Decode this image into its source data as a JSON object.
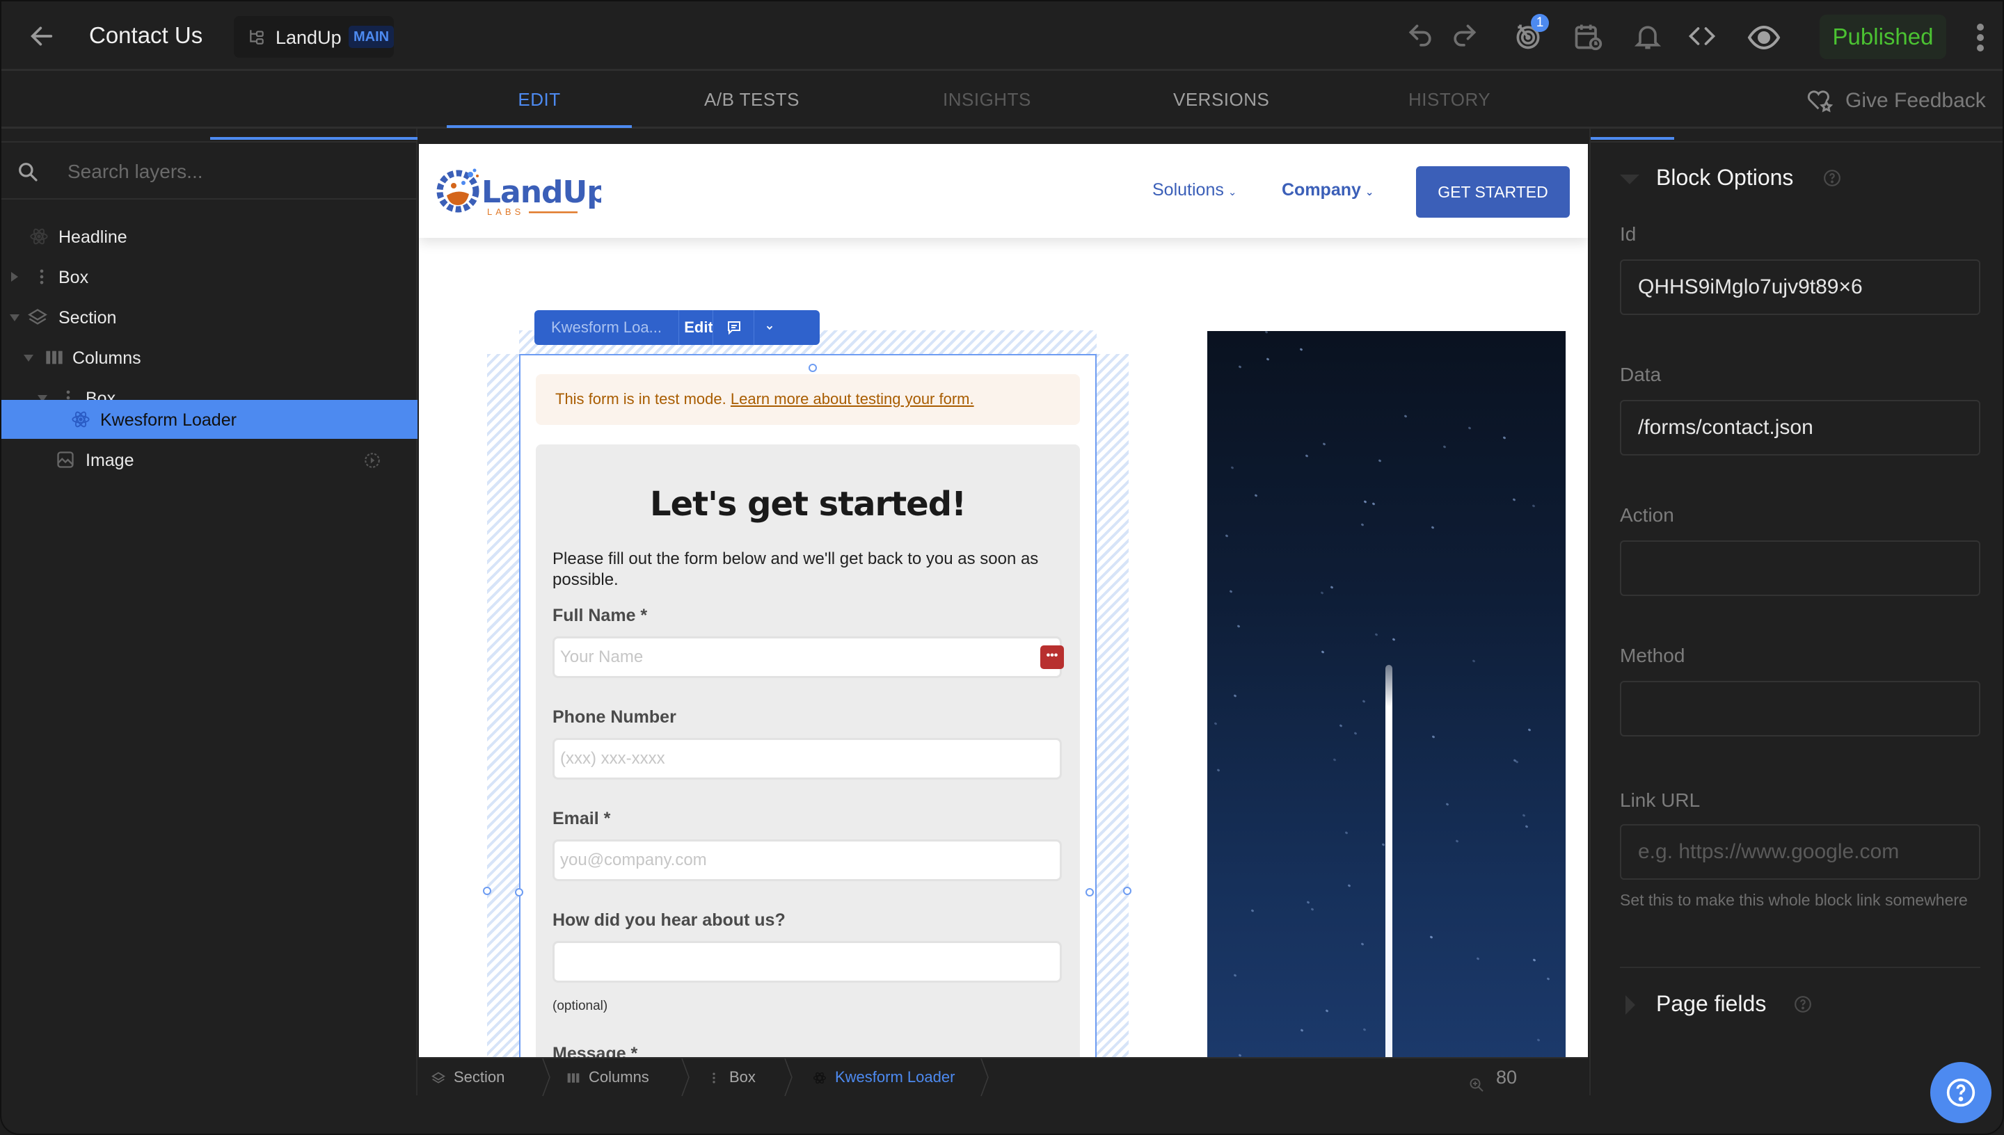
{
  "topbar": {
    "page_title": "Contact Us",
    "project_name": "LandUp",
    "branch_badge": "MAIN",
    "goals_badge_count": "1",
    "published_label": "Published",
    "icons": [
      "back-arrow-icon",
      "branch-icon",
      "undo-icon",
      "redo-icon",
      "goal-target-icon",
      "schedule-calendar-icon",
      "bell-icon",
      "code-icon",
      "eye-preview-icon",
      "more-vertical-icon"
    ]
  },
  "tabs": [
    {
      "label": "EDIT",
      "active": true,
      "color": "#4d8af0"
    },
    {
      "label": "A/B TESTS",
      "active": false,
      "color": "#a0a0a0"
    },
    {
      "label": "INSIGHTS",
      "active": false,
      "color": "#5a5a5a"
    },
    {
      "label": "VERSIONS",
      "active": false,
      "color": "#a0a0a0"
    },
    {
      "label": "HISTORY",
      "active": false,
      "color": "#5a5a5a"
    }
  ],
  "feedback_label": "Give Feedback",
  "layers": {
    "search_placeholder": "Search layers...",
    "items": [
      {
        "label": "Headline",
        "icon": "component-atom-icon",
        "depth": 0,
        "caret": "none"
      },
      {
        "label": "Box",
        "icon": "box-dots-icon",
        "depth": 0,
        "caret": "right"
      },
      {
        "label": "Section",
        "icon": "layers-icon",
        "depth": 0,
        "caret": "down"
      },
      {
        "label": "Columns",
        "icon": "columns-icon",
        "depth": 1,
        "caret": "down"
      },
      {
        "label": "Box",
        "icon": "box-dots-icon",
        "depth": 2,
        "caret": "down"
      },
      {
        "label": "Kwesform Loader",
        "icon": "component-atom-icon",
        "depth": 3,
        "caret": "none",
        "selected": true
      },
      {
        "label": "Image",
        "icon": "image-icon",
        "depth": 2,
        "caret": "none"
      }
    ]
  },
  "site": {
    "logo_text": "LandUp",
    "logo_sub": "LABS",
    "nav": [
      {
        "label": "Solutions"
      },
      {
        "label": "Company"
      }
    ],
    "cta_label": "GET STARTED"
  },
  "block_toolbar": {
    "name": "Kwesform Loa...",
    "edit_label": "Edit"
  },
  "form": {
    "test_banner_text": "This form is in test mode.",
    "test_banner_link": "Learn more about testing your form.",
    "title": "Let's get started!",
    "description": "Please fill out the form below and we'll get back to you as soon as possible.",
    "fields": [
      {
        "label": "Full Name *",
        "placeholder": "Your Name",
        "value": ""
      },
      {
        "label": "Phone Number",
        "placeholder": "(xxx) xxx-xxxx",
        "value": ""
      },
      {
        "label": "Email *",
        "placeholder": "you@company.com",
        "value": ""
      },
      {
        "label": "How did you hear about us?",
        "placeholder": "",
        "value": "",
        "hint": "(optional)"
      },
      {
        "label": "Message *"
      }
    ]
  },
  "breadcrumb": [
    {
      "label": "Section",
      "icon": "layers-icon"
    },
    {
      "label": "Columns",
      "icon": "columns-icon"
    },
    {
      "label": "Box",
      "icon": "box-dots-icon"
    },
    {
      "label": "Kwesform Loader",
      "icon": "component-atom-icon",
      "active": true
    }
  ],
  "zoom_level": "80",
  "block_options": {
    "title": "Block Options",
    "fields": [
      {
        "label": "Id",
        "value": "QHHS9iMglo7ujv9t89×6",
        "placeholder": ""
      },
      {
        "label": "Data",
        "value": "/forms/contact.json",
        "placeholder": ""
      },
      {
        "label": "Action",
        "value": "",
        "placeholder": ""
      },
      {
        "label": "Method",
        "value": "",
        "placeholder": ""
      },
      {
        "label": "Link URL",
        "value": "",
        "placeholder": "e.g. https://www.google.com",
        "hint": "Set this to make this whole block link somewhere"
      }
    ],
    "page_fields_title": "Page fields"
  },
  "colors": {
    "accent": "#4d8af0",
    "published_green": "#4bc232",
    "site_brand_blue": "#3b5fb8",
    "site_brand_orange": "#e07a2a",
    "panel_bg": "#202020"
  }
}
